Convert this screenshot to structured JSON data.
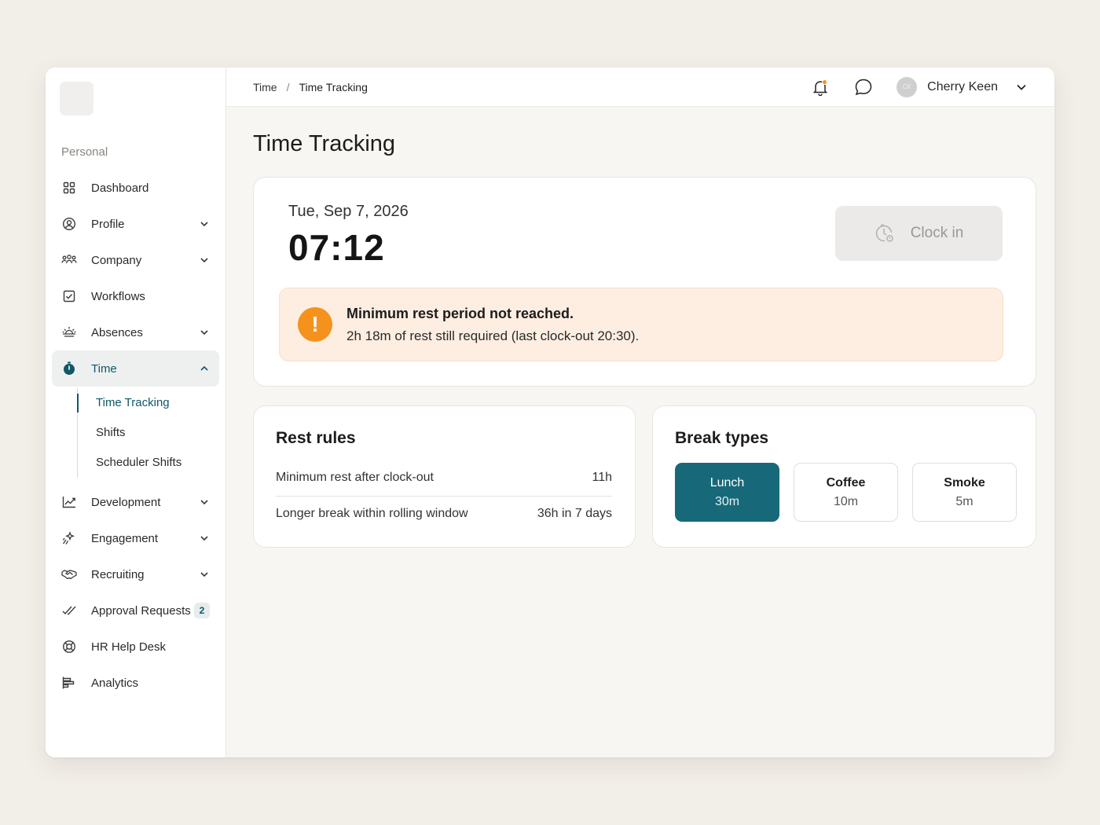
{
  "sidebar": {
    "section": "Personal",
    "items": [
      {
        "label": "Dashboard"
      },
      {
        "label": "Profile"
      },
      {
        "label": "Company"
      },
      {
        "label": "Workflows"
      },
      {
        "label": "Absences"
      },
      {
        "label": "Time"
      },
      {
        "label": "Development"
      },
      {
        "label": "Engagement"
      },
      {
        "label": "Recruiting"
      },
      {
        "label": "Approval Requests",
        "badge": "2"
      },
      {
        "label": "HR Help Desk"
      },
      {
        "label": "Analytics"
      }
    ],
    "time_sub": [
      {
        "label": "Time Tracking"
      },
      {
        "label": "Shifts"
      },
      {
        "label": "Scheduler Shifts"
      }
    ]
  },
  "header": {
    "breadcrumb": [
      "Time",
      "Time Tracking"
    ],
    "separator": "/",
    "user": {
      "name": "Cherry Keen",
      "initials": "CK"
    }
  },
  "page": {
    "title": "Time Tracking",
    "date": "Tue, Sep 7, 2026",
    "time": "07:12",
    "clock_in_label": "Clock in",
    "alert": {
      "title": "Minimum rest period not reached.",
      "text": "2h 18m of rest still required (last clock-out 20:30).",
      "icon": "!"
    },
    "rest_rules": {
      "title": "Rest rules",
      "rows": [
        {
          "label": "Minimum rest after clock-out",
          "value": "11h"
        },
        {
          "label": "Longer break within rolling window",
          "value": "36h in 7 days"
        }
      ]
    },
    "break_types": {
      "title": "Break types",
      "items": [
        {
          "name": "Lunch",
          "duration": "30m"
        },
        {
          "name": "Coffee",
          "duration": "10m"
        },
        {
          "name": "Smoke",
          "duration": "5m"
        }
      ]
    }
  },
  "colors": {
    "accent": "#17697a",
    "alert_bg": "#fdeee1",
    "alert_icon": "#f5921e",
    "notification_dot": "#f5921e"
  }
}
